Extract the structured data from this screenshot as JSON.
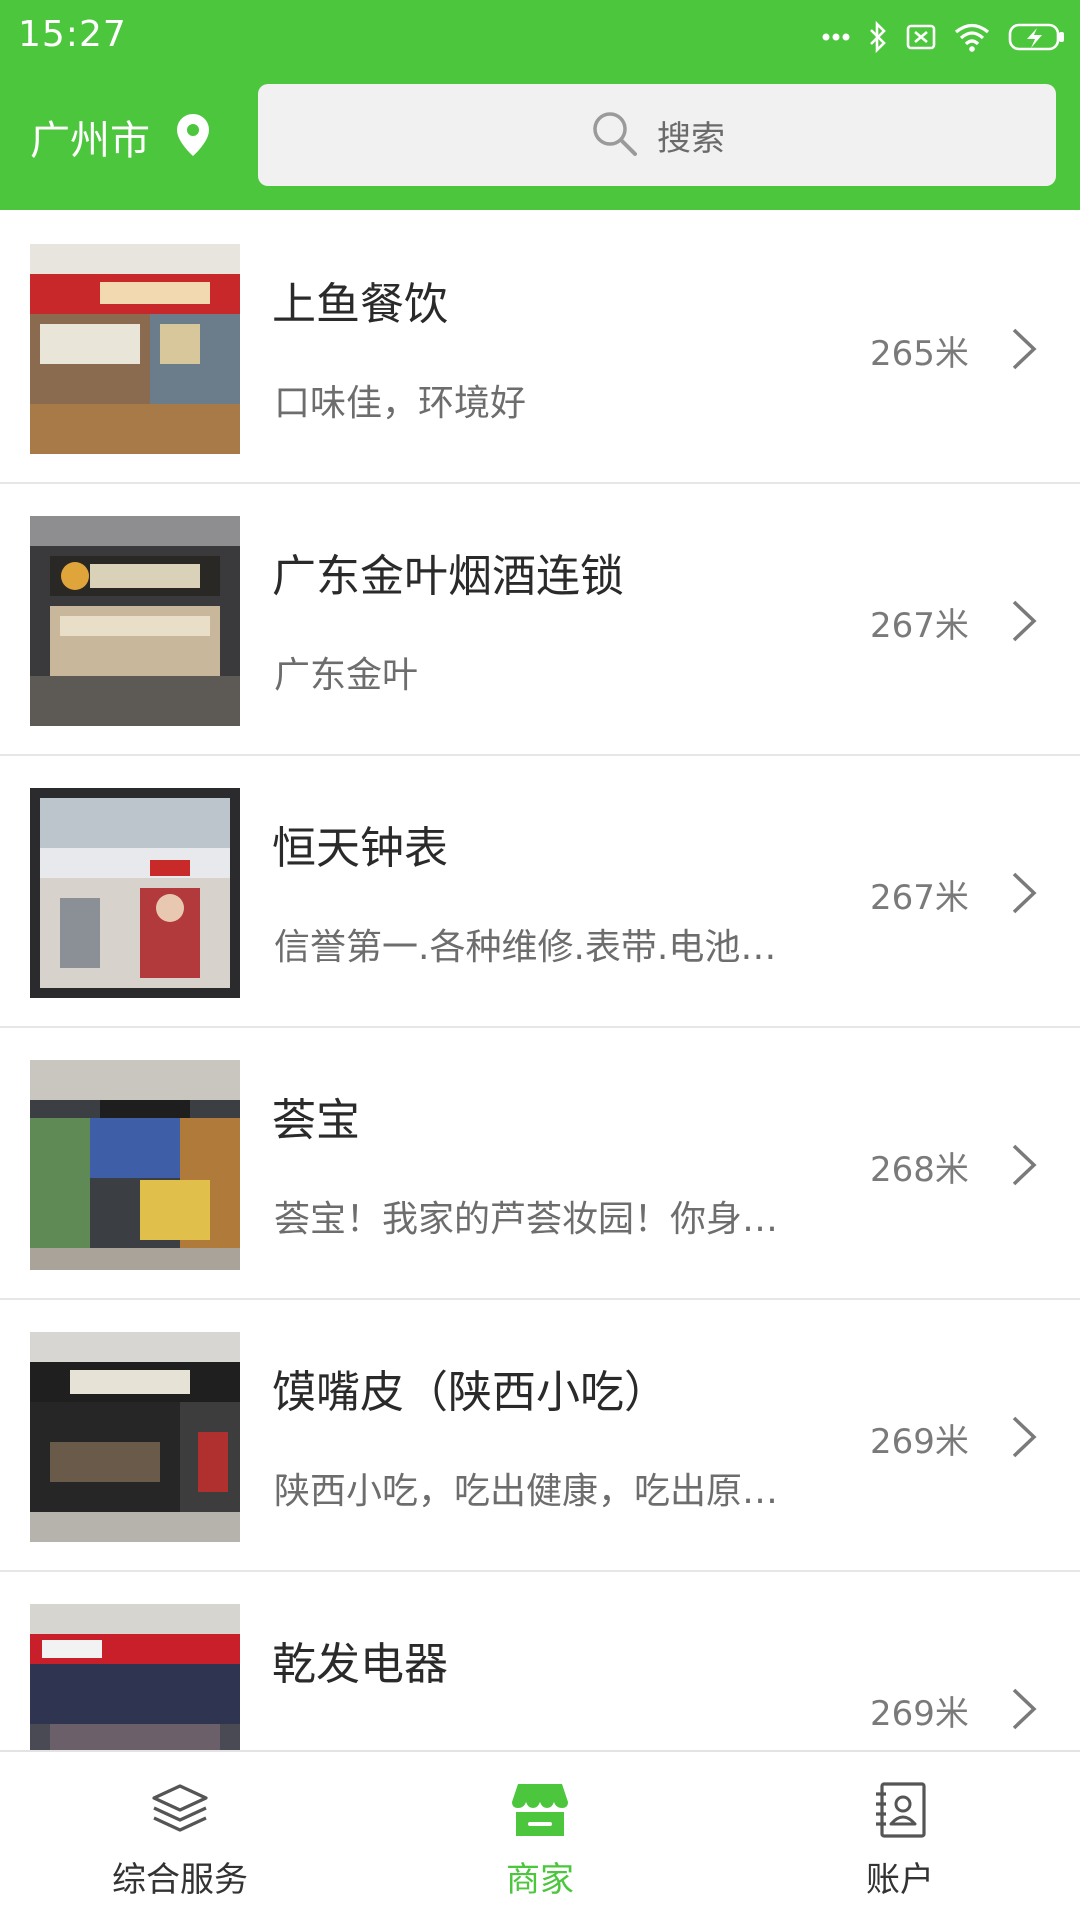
{
  "status_bar": {
    "time": "15:27"
  },
  "header": {
    "city": "广州市",
    "search": {
      "placeholder": "搜索"
    }
  },
  "merchants": [
    {
      "name": "上鱼餐饮",
      "description": "口味佳，环境好",
      "distance": "265米"
    },
    {
      "name": "广东金叶烟酒连锁",
      "description": "广东金叶",
      "distance": "267米"
    },
    {
      "name": "恒天钟表",
      "description": "信誉第一.各种维修.表带.电池…",
      "distance": "267米"
    },
    {
      "name": "荟宝",
      "description": "荟宝！我家的芦荟妆园！你身…",
      "distance": "268米"
    },
    {
      "name": "馍嘴皮（陕西小吃）",
      "description": "陕西小吃，吃出健康，吃出原…",
      "distance": "269米"
    },
    {
      "name": "乾发电器",
      "description": "",
      "distance": "269米"
    }
  ],
  "bottom_nav": {
    "items": [
      {
        "label": "综合服务",
        "icon": "layers-icon"
      },
      {
        "label": "商家",
        "icon": "store-icon"
      },
      {
        "label": "账户",
        "icon": "account-book-icon"
      }
    ],
    "active_index": 1
  },
  "colors": {
    "brand_green": "#4cc63c",
    "divider": "#e6e6e6",
    "text_primary": "#2a2a2a",
    "text_secondary": "#6d6d6d"
  }
}
